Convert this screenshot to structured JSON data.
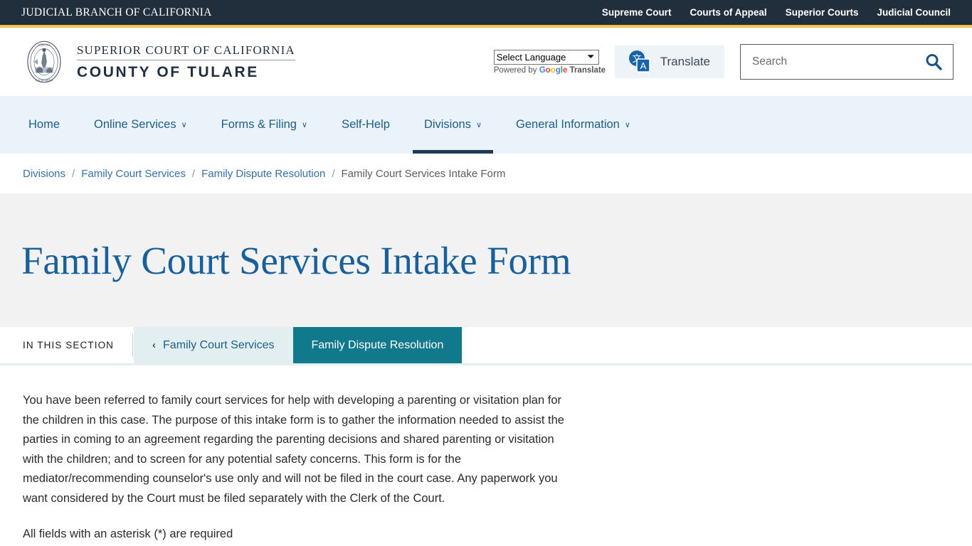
{
  "topbar": {
    "brand": "JUDICIAL BRANCH OF CALIFORNIA",
    "links": [
      {
        "label": "Supreme Court"
      },
      {
        "label": "Courts of Appeal"
      },
      {
        "label": "Superior Courts"
      },
      {
        "label": "Judicial Council"
      }
    ]
  },
  "masthead": {
    "seal_alt": "judicial-branch-seal",
    "wordmark_top": "SUPERIOR COURT OF CALIFORNIA",
    "wordmark_bottom": "COUNTY OF TULARE",
    "translate": {
      "select_value": "Select Language",
      "caret": "⌄",
      "powered_prefix": "Powered by",
      "powered_google": "Google",
      "powered_suffix": "Translate",
      "button_label": "Translate",
      "icon_cjk": "文",
      "icon_latin": "A"
    },
    "search": {
      "placeholder": "Search",
      "value": ""
    }
  },
  "mainnav": {
    "items": [
      {
        "label": "Home",
        "has_chevron": false,
        "active": false
      },
      {
        "label": "Online Services",
        "has_chevron": true,
        "active": false
      },
      {
        "label": "Forms & Filing",
        "has_chevron": true,
        "active": false
      },
      {
        "label": "Self-Help",
        "has_chevron": false,
        "active": false
      },
      {
        "label": "Divisions",
        "has_chevron": true,
        "active": true
      },
      {
        "label": "General Information",
        "has_chevron": true,
        "active": false
      }
    ],
    "chevron_glyph": "∨"
  },
  "breadcrumb": {
    "separator": "/",
    "items": [
      {
        "label": "Divisions",
        "current": false
      },
      {
        "label": "Family Court Services",
        "current": false
      },
      {
        "label": "Family Dispute Resolution",
        "current": false
      },
      {
        "label": "Family Court Services Intake Form",
        "current": true
      }
    ]
  },
  "hero": {
    "title": "Family Court Services Intake Form"
  },
  "section_tabs": {
    "label": "IN THIS SECTION",
    "back_chevron": "‹",
    "parent_tab": "Family Court Services",
    "active_tab": "Family Dispute Resolution"
  },
  "content": {
    "paragraphs": [
      "You have been referred to family court services for help with developing a parenting or visitation plan for the children in this case. The purpose of this intake form is to gather the information needed to assist the parties in coming to an agreement regarding the parenting decisions and shared parenting or visitation with the children; and to screen for any potential safety concerns. This form is for the mediator/recommending counselor's use only and will not be filed in the court case. Any paperwork you want considered by the Court must be filed separately with the Clerk of the Court.",
      "All fields with an asterisk (*) are required"
    ]
  },
  "colors": {
    "topbar_bg": "#212f3d",
    "gold_rule": "#eec45a",
    "nav_bg": "#eaf2fa",
    "nav_link": "#1b5e8e",
    "nav_active_underline": "#1f3a54",
    "hero_bg": "#f2f2f2",
    "hero_title": "#17609e",
    "tab_active_bg": "#11798c",
    "tab_parent_bg": "#e2eef0",
    "breadcrumb_link": "#2f72b5",
    "search_icon": "#14568c"
  }
}
